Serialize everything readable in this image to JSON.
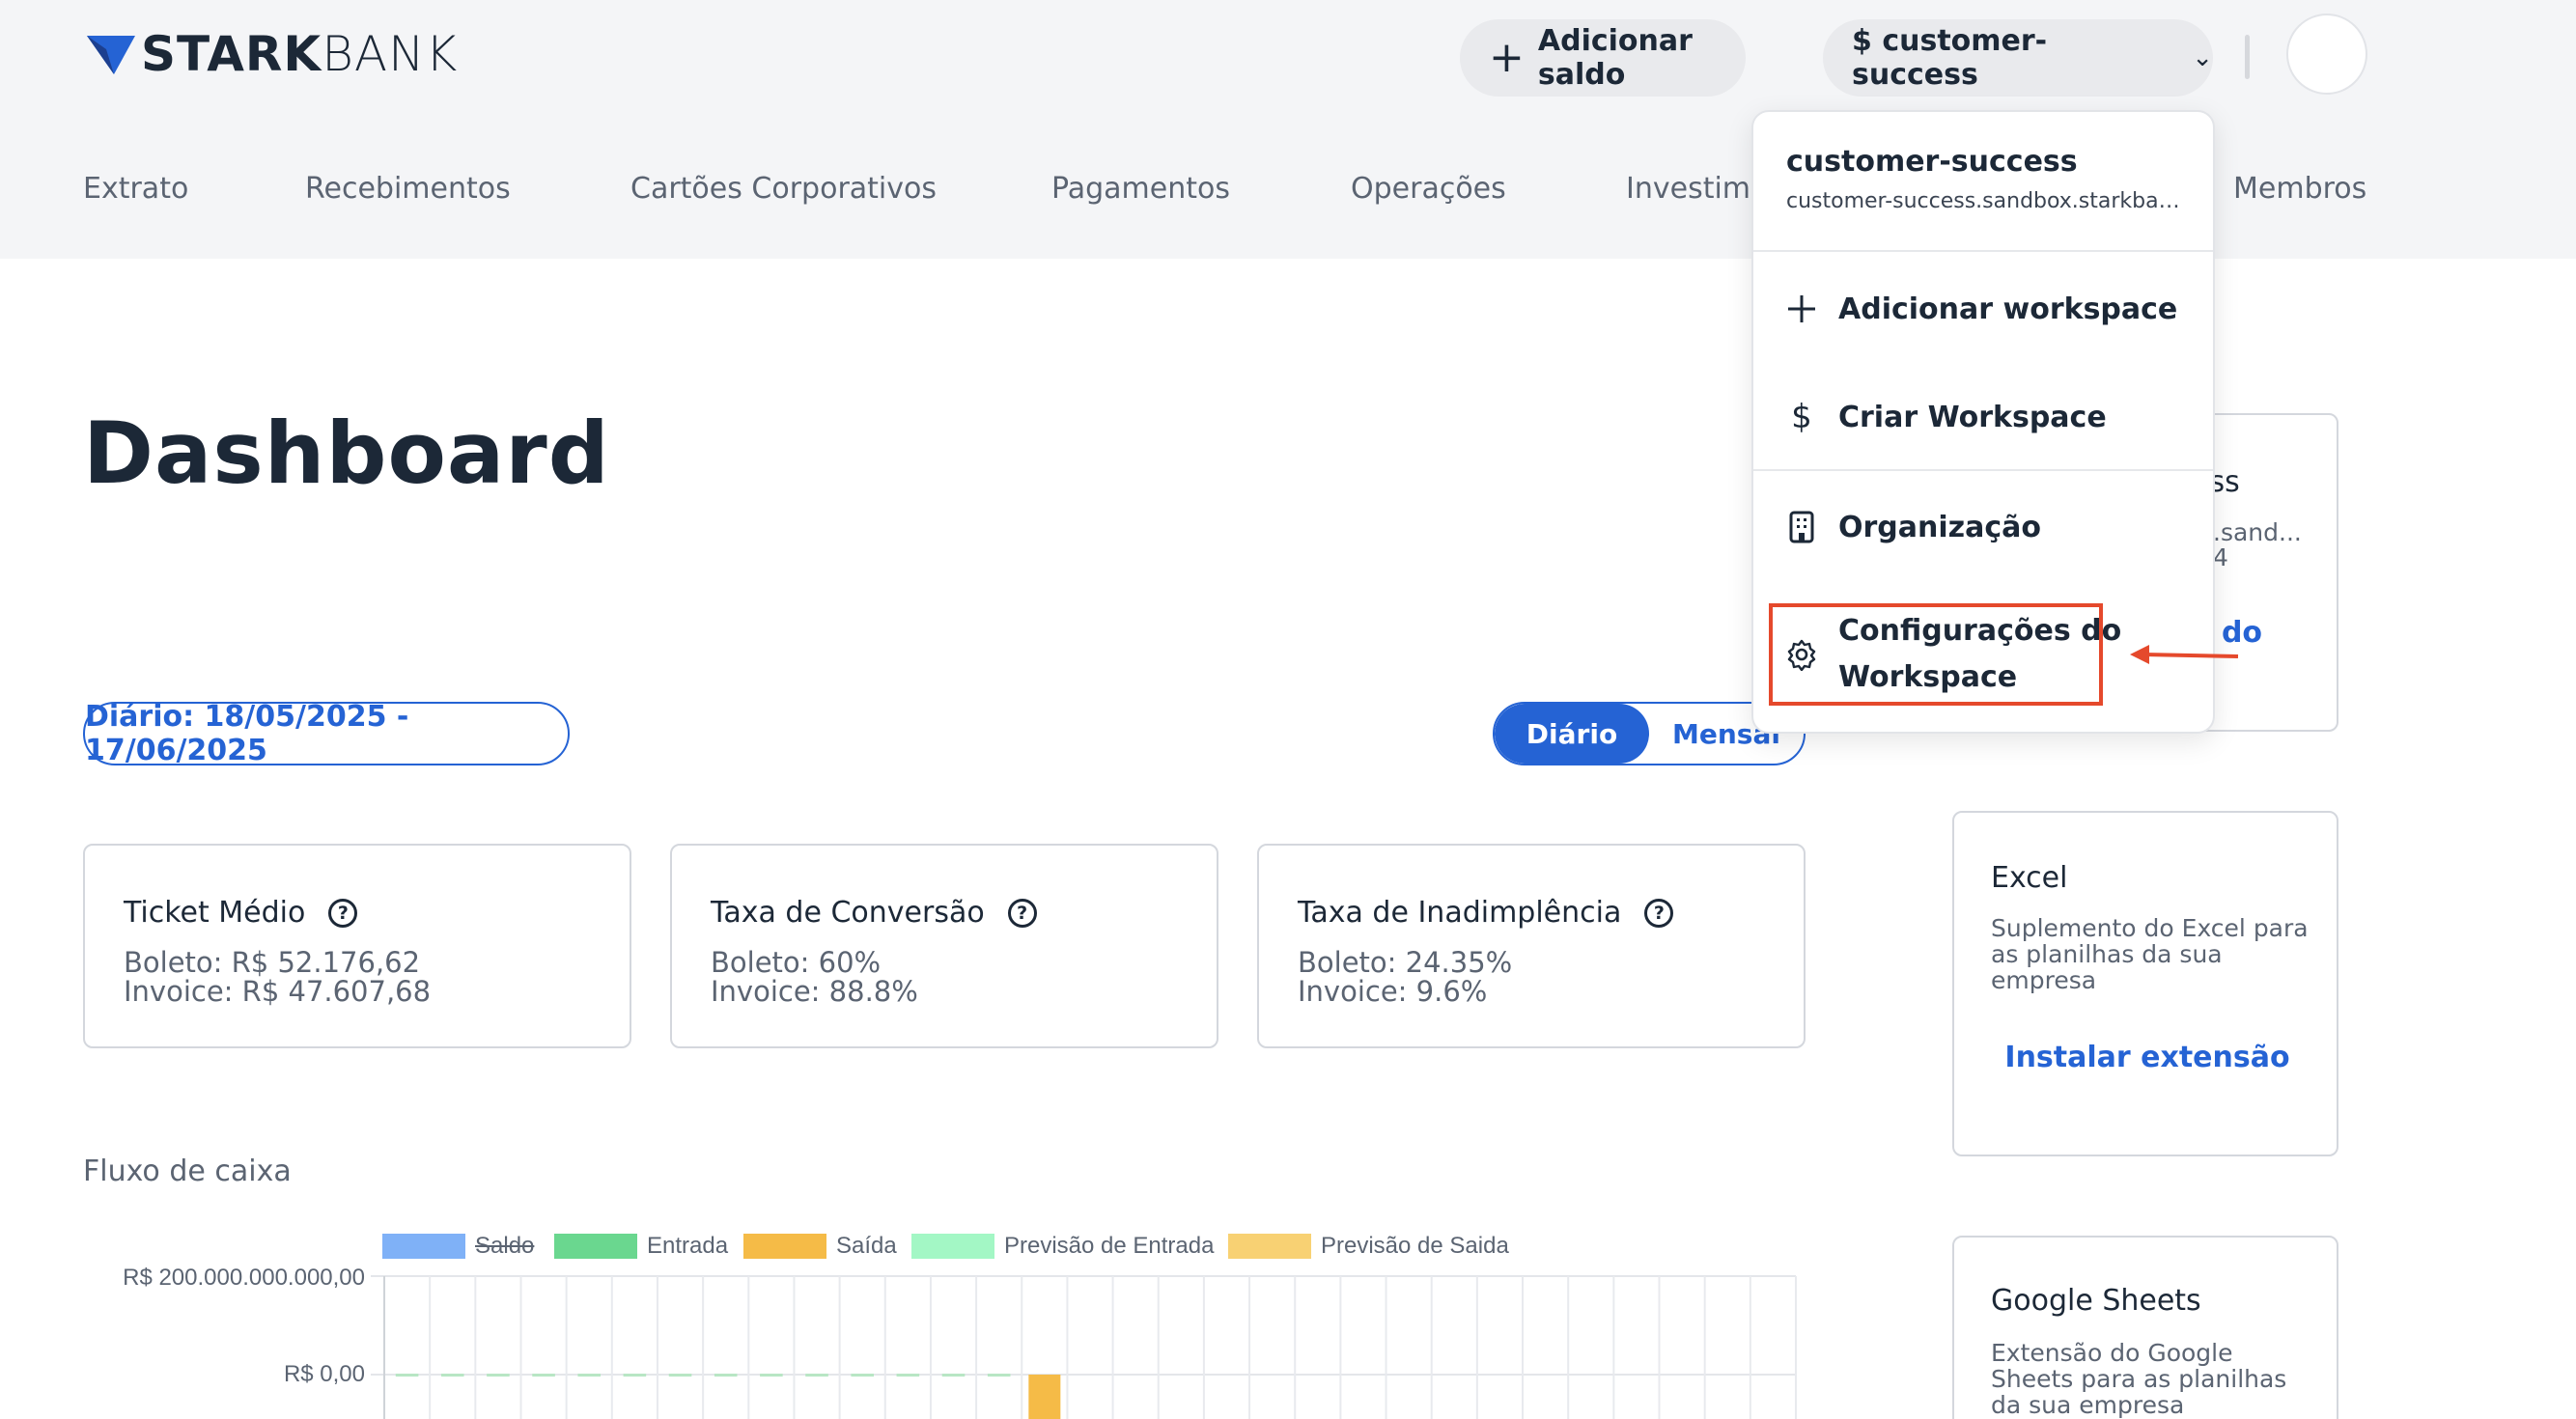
{
  "brand": {
    "part1": "STARK",
    "part2": "BANK",
    "accent": "#2563d4"
  },
  "header": {
    "add_balance_label": "Adicionar saldo",
    "workspace_label": "$ customer-success"
  },
  "nav": {
    "items": [
      "Extrato",
      "Recebimentos",
      "Cartões Corporativos",
      "Pagamentos",
      "Operações",
      "Investime",
      "Membros"
    ]
  },
  "main": {
    "title": "Dashboard",
    "date_range": "Diário: 18/05/2025 - 17/06/2025",
    "period_toggle": {
      "active": "Diário",
      "inactive": "Mensal"
    },
    "metrics": [
      {
        "title": "Ticket Médio",
        "line1": "Boleto: R$ 52.176,62",
        "line2": "Invoice: R$ 47.607,68"
      },
      {
        "title": "Taxa de Conversão",
        "line1": "Boleto: 60%",
        "line2": "Invoice: 88.8%"
      },
      {
        "title": "Taxa de Inadimplência",
        "line1": "Boleto: 24.35%",
        "line2": "Invoice: 9.6%"
      }
    ],
    "cashflow_label": "Fluxo de caixa"
  },
  "chart_data": {
    "type": "bar",
    "legend": [
      {
        "name": "Saldo",
        "color": "#7fb1f7",
        "hidden": true
      },
      {
        "name": "Entrada",
        "color": "#6ad78f",
        "hidden": false
      },
      {
        "name": "Saída",
        "color": "#f5bb47",
        "hidden": false
      },
      {
        "name": "Previsão de Entrada",
        "color": "#a3f7c5",
        "hidden": false
      },
      {
        "name": "Previsão de Saida",
        "color": "#f8d173",
        "hidden": false
      }
    ],
    "y_ticks": [
      "R$  200.000.000.000,00",
      "R$  0,00"
    ],
    "visible_bar": {
      "series": "Saída",
      "category_index": 14
    }
  },
  "side": {
    "workspace_card": {
      "title_tail": "ess",
      "sub_tail": ".sand...",
      "sub2_tail": "4",
      "link_tail": "do"
    },
    "excel": {
      "title": "Excel",
      "desc": "Suplemento do Excel para as planilhas da sua empresa",
      "action": "Instalar extensão"
    },
    "sheets": {
      "title": "Google Sheets",
      "desc": "Extensão do Google Sheets para as planilhas da sua empresa"
    }
  },
  "dropdown": {
    "name": "customer-success",
    "domain": "customer-success.sandbox.starkbank.com",
    "items": [
      {
        "icon": "plus-icon",
        "label": "Adicionar workspace"
      },
      {
        "icon": "dollar-icon",
        "label": "Criar Workspace"
      },
      {
        "icon": "building-icon",
        "label": "Organização"
      },
      {
        "icon": "gear-icon",
        "label_line1": "Configurações do",
        "label_line2": "Workspace"
      }
    ],
    "highlight_color": "#e5492c"
  }
}
